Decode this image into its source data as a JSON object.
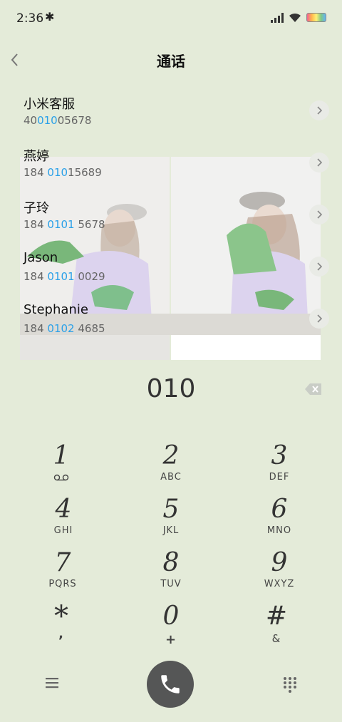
{
  "status": {
    "time": "2:36"
  },
  "header": {
    "title": "通话"
  },
  "contacts": [
    {
      "name": "小米客服",
      "num_pre": "40",
      "num_hl": "010",
      "num_post": "05678"
    },
    {
      "name": "燕婷",
      "num_pre": "184 ",
      "num_hl": "010",
      "num_post": "15689"
    },
    {
      "name": "子玲",
      "num_pre": "184 ",
      "num_hl": "0101",
      "num_post": " 5678"
    },
    {
      "name": "Jason",
      "num_pre": "184 ",
      "num_hl": "0101",
      "num_post": " 0029"
    },
    {
      "name": "Stephanie",
      "num_pre": "184 ",
      "num_hl": "0102",
      "num_post": " 4685"
    }
  ],
  "dialer": {
    "entry": "010",
    "keys": [
      {
        "digit": "1",
        "letters": ""
      },
      {
        "digit": "2",
        "letters": "ABC"
      },
      {
        "digit": "3",
        "letters": "DEF"
      },
      {
        "digit": "4",
        "letters": "GHI"
      },
      {
        "digit": "5",
        "letters": "JKL"
      },
      {
        "digit": "6",
        "letters": "MNO"
      },
      {
        "digit": "7",
        "letters": "PQRS"
      },
      {
        "digit": "8",
        "letters": "TUV"
      },
      {
        "digit": "9",
        "letters": "WXYZ"
      },
      {
        "digit": "*",
        "letters": ","
      },
      {
        "digit": "0",
        "letters": "+"
      },
      {
        "digit": "#",
        "letters": "&"
      }
    ]
  },
  "icons": {
    "back": "chevron-left-icon",
    "voicemail": "voicemail-icon",
    "backspace": "backspace-icon",
    "menu": "menu-icon",
    "call": "phone-icon",
    "keypad": "keypad-icon"
  },
  "colors": {
    "background": "#e4ebd9",
    "highlight": "#2aa0e8",
    "call_button": "#555656"
  }
}
